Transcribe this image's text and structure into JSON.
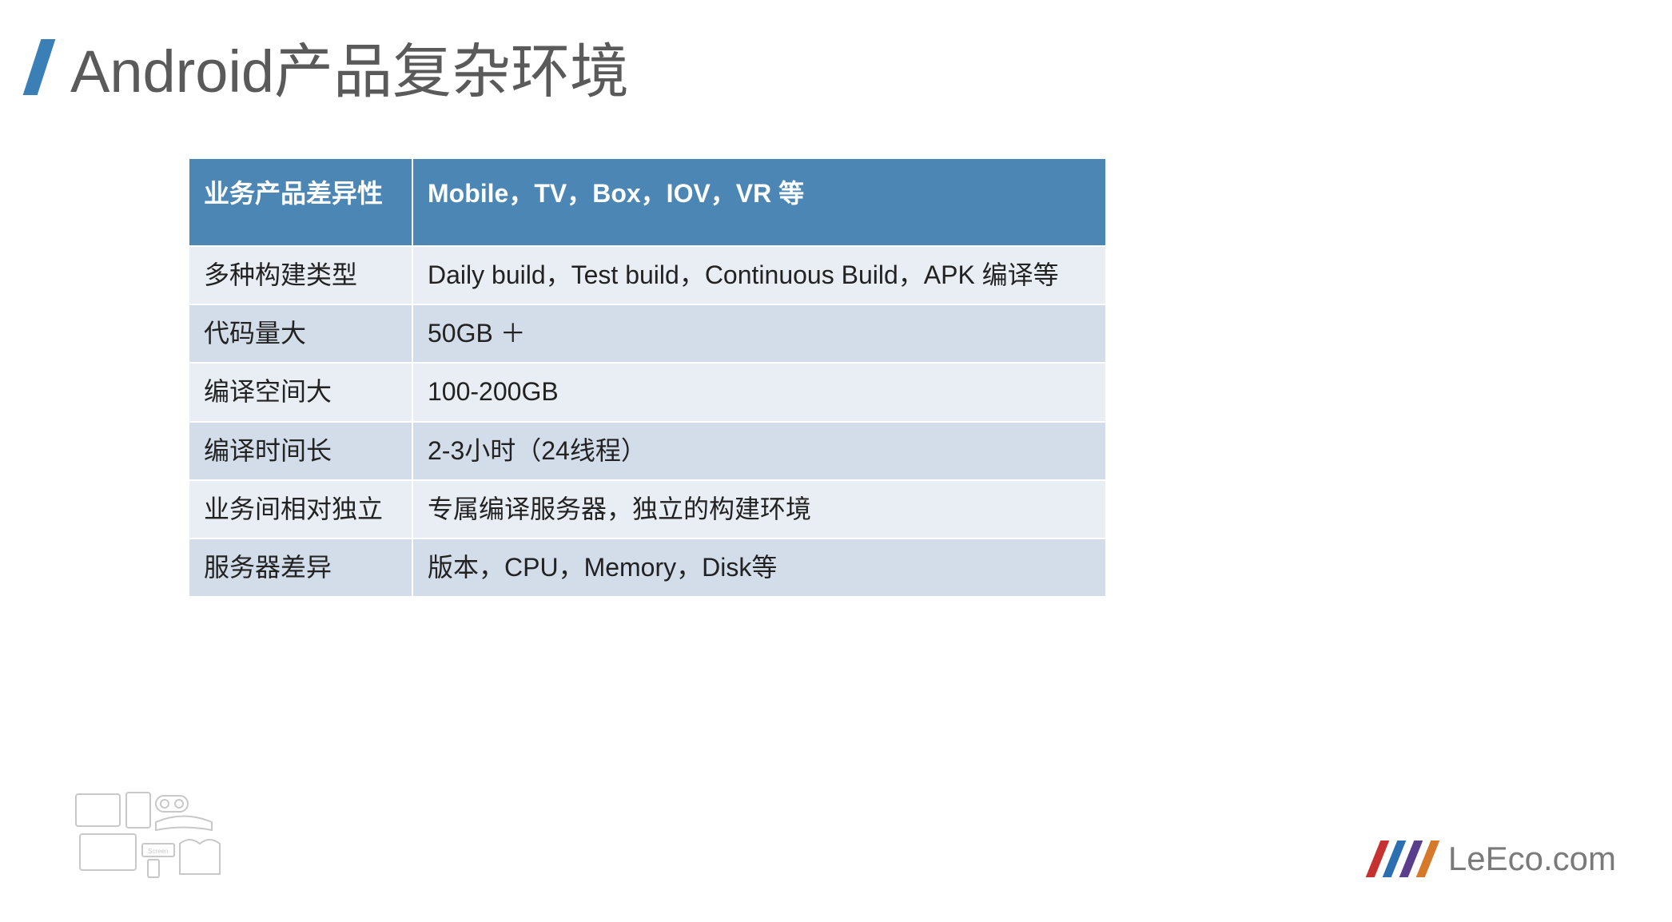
{
  "title": "Android产品复杂环境",
  "table": {
    "header": {
      "label": "业务产品差异性",
      "value": "Mobile，TV，Box，IOV，VR 等"
    },
    "rows": [
      {
        "label": "多种构建类型",
        "value": "Daily build，Test build，Continuous Build，APK 编译等"
      },
      {
        "label": "代码量大",
        "value": "50GB ＋"
      },
      {
        "label": "编译空间大",
        "value": "100-200GB"
      },
      {
        "label": "编译时间长",
        "value": "2-3小时（24线程）"
      },
      {
        "label": "业务间相对独立",
        "value": "专属编译服务器，独立的构建环境"
      },
      {
        "label": "服务器差异",
        "value": "版本，CPU，Memory，Disk等"
      }
    ]
  },
  "brand": "LeEco.com"
}
